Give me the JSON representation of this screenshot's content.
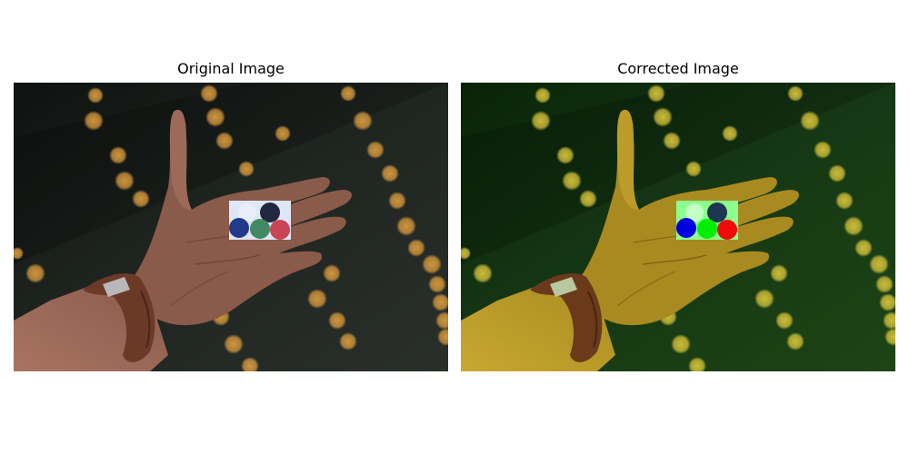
{
  "panels": [
    {
      "title": "Original Image",
      "palette": {
        "bg_top": "#1e2420",
        "bg_bottom": "#2a2f2a",
        "bg_left": "#0f1210",
        "bokeh": "#d79a3e",
        "skin": "#8a5a4a",
        "skin_dark": "#5e3a30",
        "skin_light": "#a87462",
        "watch": "#6b3a26",
        "buckle": "#b8b8b8",
        "card": "#dfe6f6",
        "dot1": "#e8eef9",
        "dot2": "#22283f",
        "dot3": "#223a8a",
        "dot4": "#3f8a62",
        "dot5": "#c94457"
      }
    },
    {
      "title": "Corrected Image",
      "palette": {
        "bg_top": "#153614",
        "bg_bottom": "#1e4414",
        "bg_left": "#082408",
        "bokeh": "#d4c23a",
        "skin": "#a88a20",
        "skin_dark": "#6a4a10",
        "skin_light": "#c8a830",
        "watch": "#6a3a1a",
        "buckle": "#b8c8a0",
        "card": "#8cff8c",
        "dot1": "#c4ffc4",
        "dot2": "#1f3650",
        "dot3": "#0000e0",
        "dot4": "#00ee00",
        "dot5": "#ee0b0b"
      }
    }
  ]
}
